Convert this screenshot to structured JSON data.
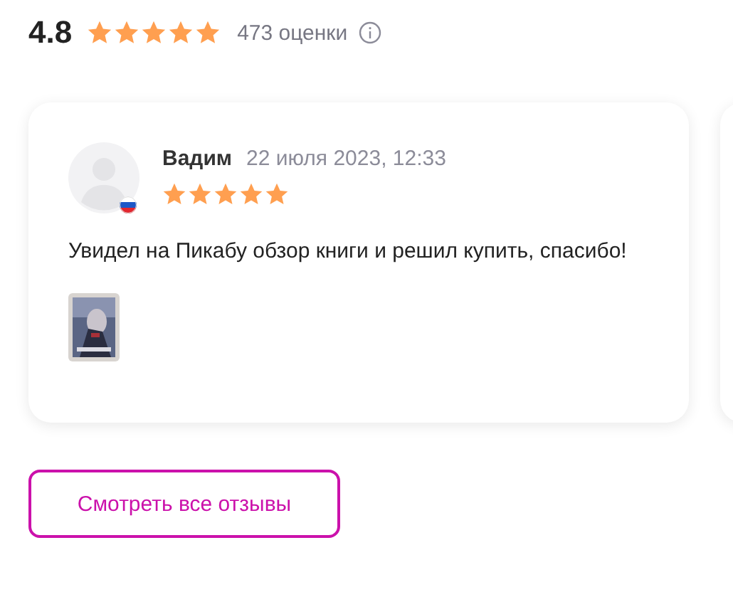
{
  "summary": {
    "rating": "4.8",
    "stars": 5,
    "count": "473 оценки"
  },
  "reviews": [
    {
      "author": "Вадим",
      "date": "22 июля 2023, 12:33",
      "stars": 5,
      "text": "Увидел на Пикабу обзор книги и решил купить, спасибо!",
      "attachments": [
        {
          "kind": "picture"
        }
      ]
    }
  ],
  "more_button": "Смотреть все отзывы"
}
